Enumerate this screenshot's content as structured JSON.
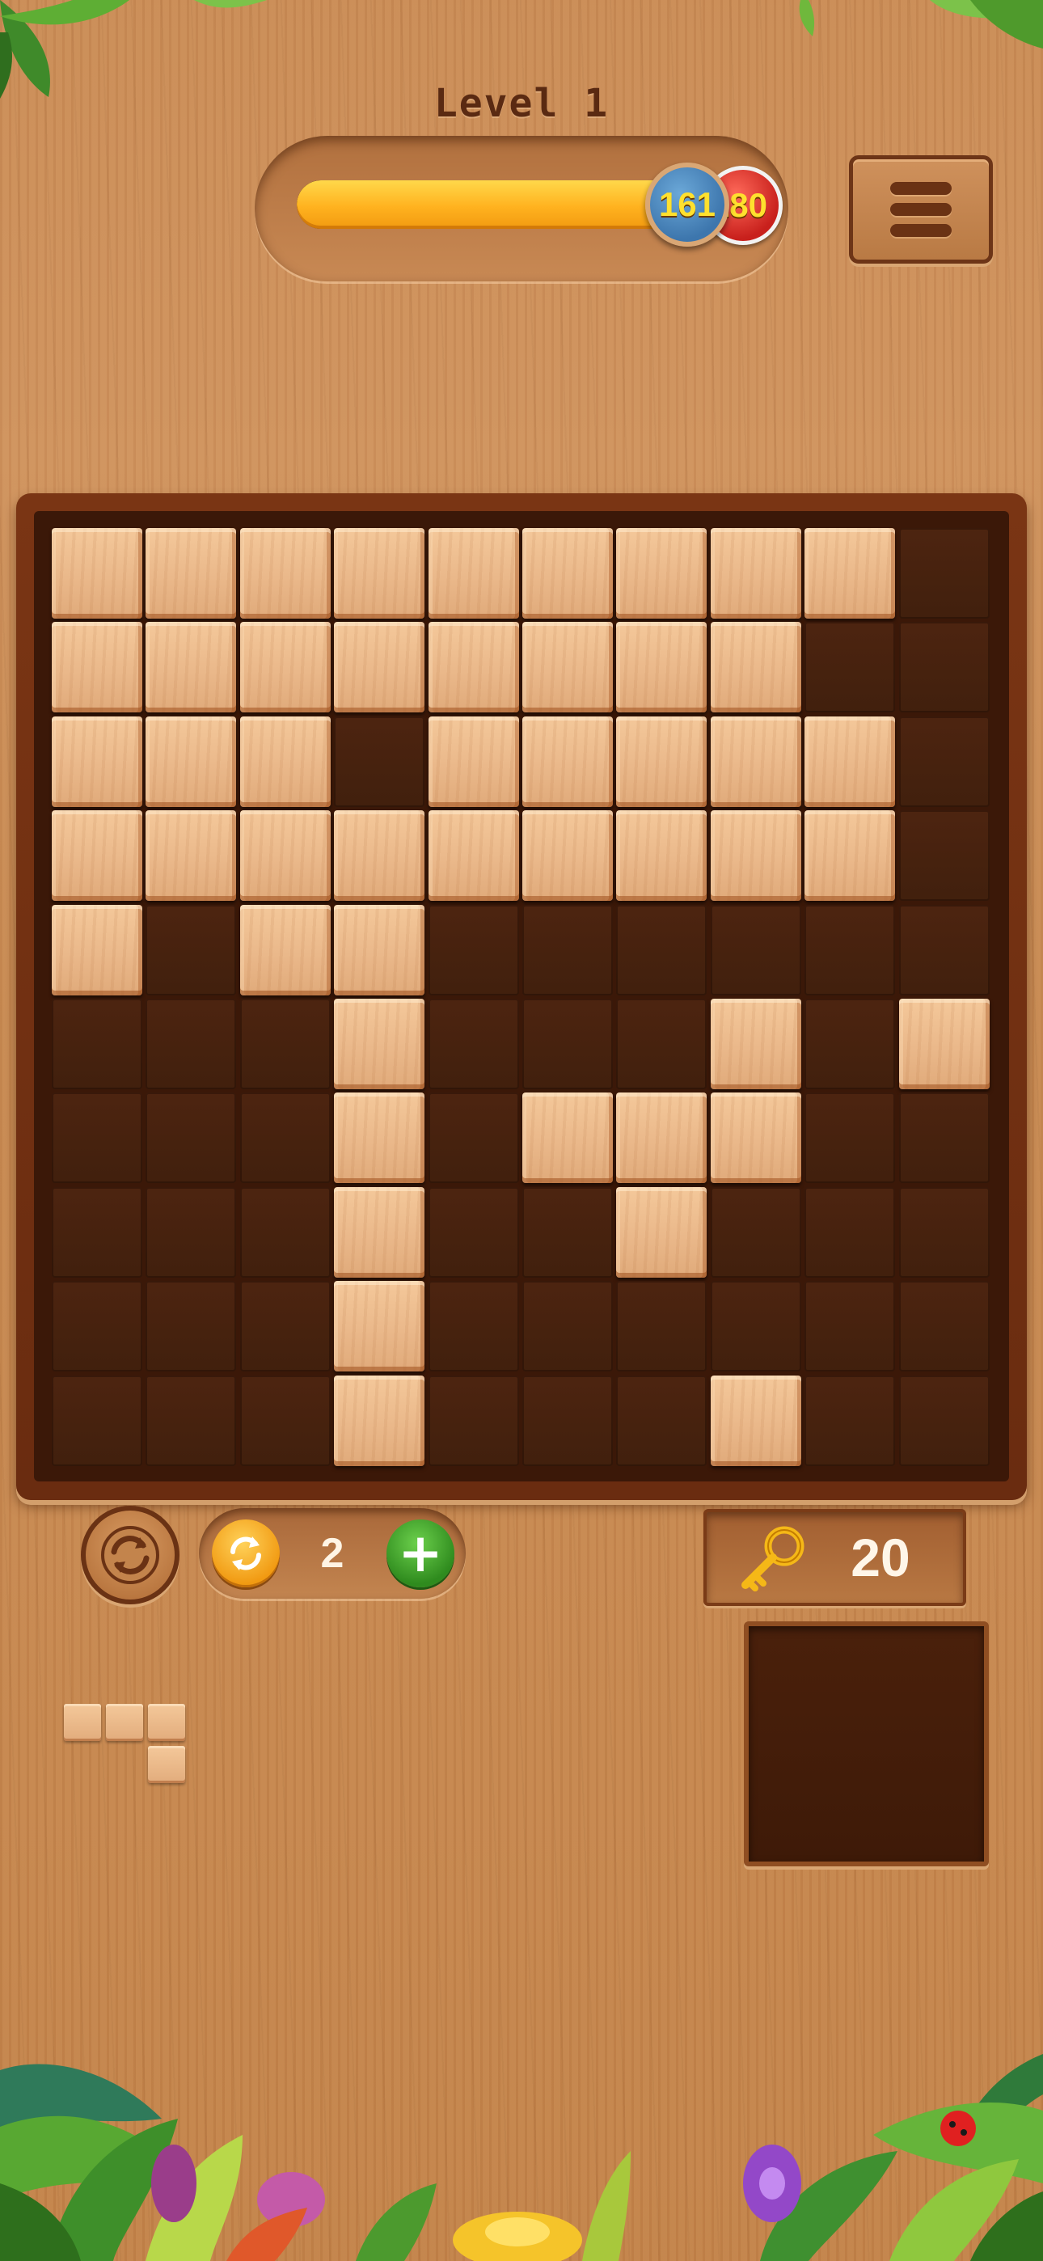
{
  "header": {
    "level_label": "Level 1",
    "score": "161",
    "target_score": "180",
    "progress_fraction": 0.89
  },
  "board": {
    "rows": 10,
    "cols": 10,
    "grid": [
      "1111111110",
      "1111111100",
      "1110111110",
      "1111111110",
      "1011000000",
      "0001000101",
      "0001011100",
      "0001001000",
      "0001000000",
      "0001000100"
    ]
  },
  "controls": {
    "rotate_count": "2",
    "add_symbol": "+",
    "keys_count": "20"
  },
  "tray": {
    "piece_cells": [
      [
        0,
        0
      ],
      [
        0,
        1
      ],
      [
        0,
        2
      ],
      [
        1,
        2
      ]
    ]
  },
  "icons": {
    "menu": "hamburger-menu-icon",
    "refresh": "refresh-icon",
    "rotate": "rotate-icon",
    "key": "key-icon"
  },
  "colors": {
    "block_wood": "#eab88a",
    "empty_cell": "#45210e",
    "progress_fill": "#ffb21f",
    "score_coin": "#3d76ad",
    "target_coin": "#c8201c",
    "add_button": "#2f8b1e"
  }
}
